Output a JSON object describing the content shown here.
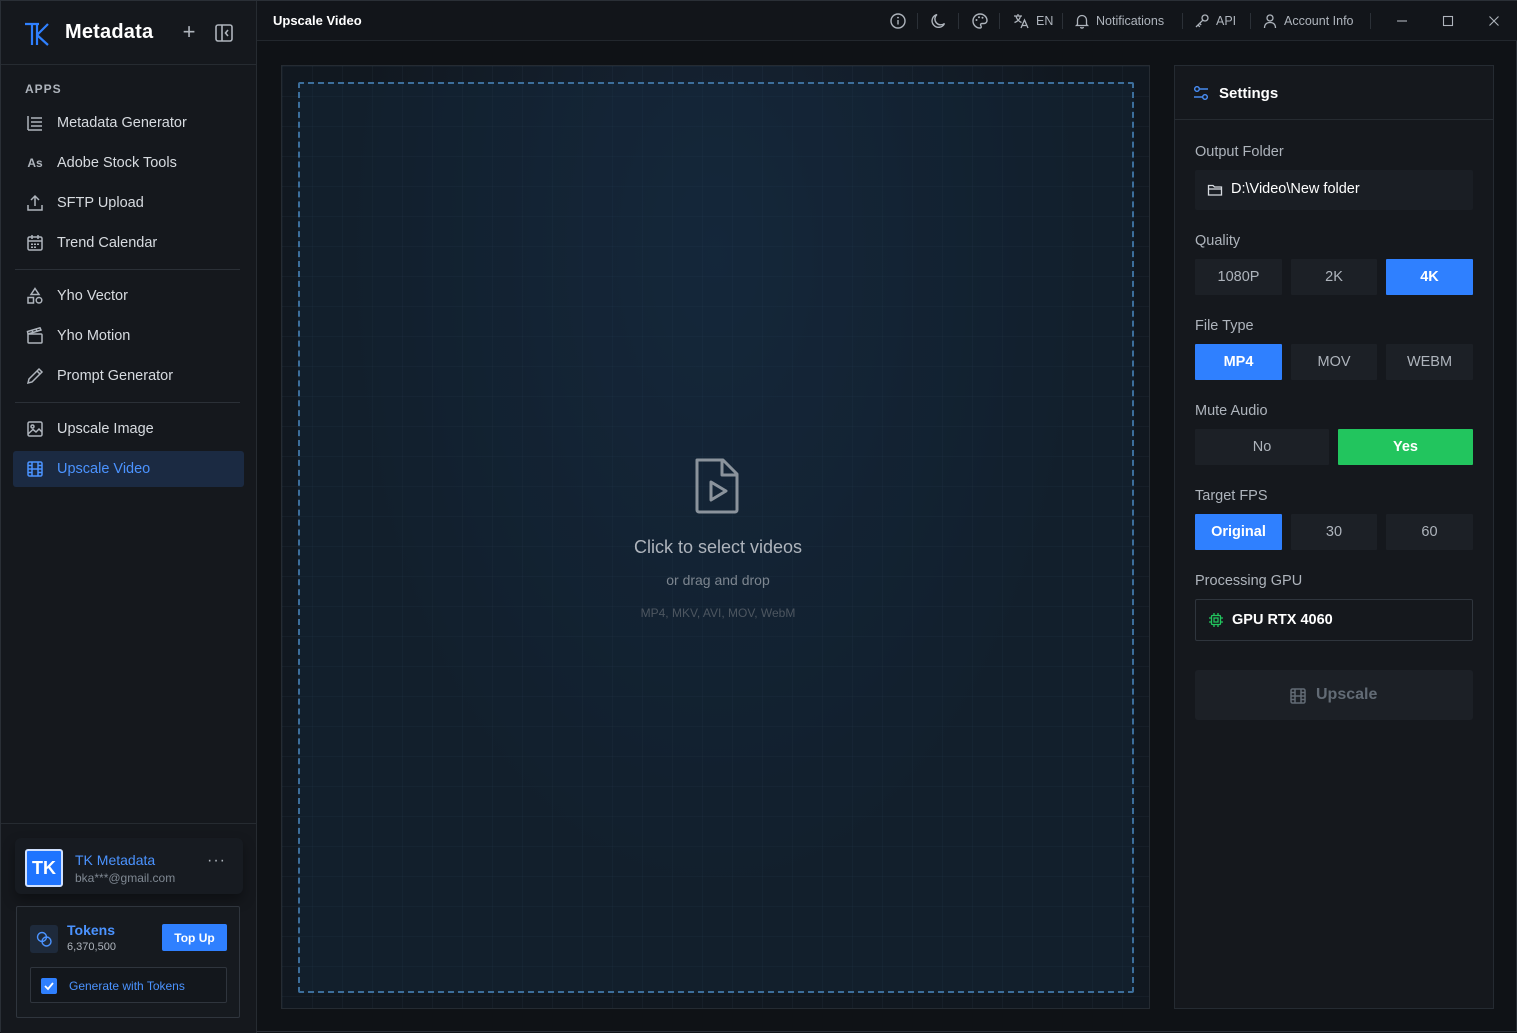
{
  "app": {
    "name": "Metadata",
    "brand_color": "#2f80ff"
  },
  "sidebar": {
    "section_label": "APPS",
    "items": [
      {
        "label": "Metadata Generator",
        "icon": "list-icon"
      },
      {
        "label": "Adobe Stock Tools",
        "icon": "adobe-stock-icon",
        "icon_text": "As"
      },
      {
        "label": "SFTP Upload",
        "icon": "upload-icon"
      },
      {
        "label": "Trend Calendar",
        "icon": "calendar-icon"
      },
      {
        "label": "Yho Vector",
        "icon": "shapes-icon"
      },
      {
        "label": "Yho Motion",
        "icon": "clapperboard-icon"
      },
      {
        "label": "Prompt Generator",
        "icon": "pencil-icon"
      },
      {
        "label": "Upscale Image",
        "icon": "image-icon"
      },
      {
        "label": "Upscale Video",
        "icon": "film-icon",
        "active": true
      }
    ],
    "user": {
      "avatar_initials": "TK",
      "name": "TK Metadata",
      "email": "bka***@gmail.com",
      "more": "···"
    },
    "tokens": {
      "label": "Tokens",
      "count": "6,370,500",
      "top_up_label": "Top Up",
      "generate_label": "Generate with Tokens",
      "generate_checked": true
    }
  },
  "titlebar": {
    "page_title": "Upscale Video",
    "language": "EN",
    "notifications": "Notifications",
    "api": "API",
    "account": "Account Info"
  },
  "dropzone": {
    "title": "Click to select videos",
    "subtitle": "or drag and drop",
    "formats": "MP4, MKV, AVI, MOV, WebM"
  },
  "settings": {
    "title": "Settings",
    "output_folder": {
      "label": "Output Folder",
      "value": "D:\\Video\\New folder"
    },
    "quality": {
      "label": "Quality",
      "options": [
        "1080P",
        "2K",
        "4K"
      ],
      "selected": "4K"
    },
    "file_type": {
      "label": "File Type",
      "options": [
        "MP4",
        "MOV",
        "WEBM"
      ],
      "selected": "MP4"
    },
    "mute_audio": {
      "label": "Mute Audio",
      "options": [
        "No",
        "Yes"
      ],
      "selected": "Yes"
    },
    "target_fps": {
      "label": "Target FPS",
      "options": [
        "Original",
        "30",
        "60"
      ],
      "selected": "Original"
    },
    "gpu": {
      "label": "Processing GPU",
      "value": "GPU RTX 4060"
    },
    "upscale_label": "Upscale"
  },
  "colors": {
    "accent_blue": "#2f80ff",
    "accent_green": "#22c55e",
    "background": "#0f1216"
  }
}
